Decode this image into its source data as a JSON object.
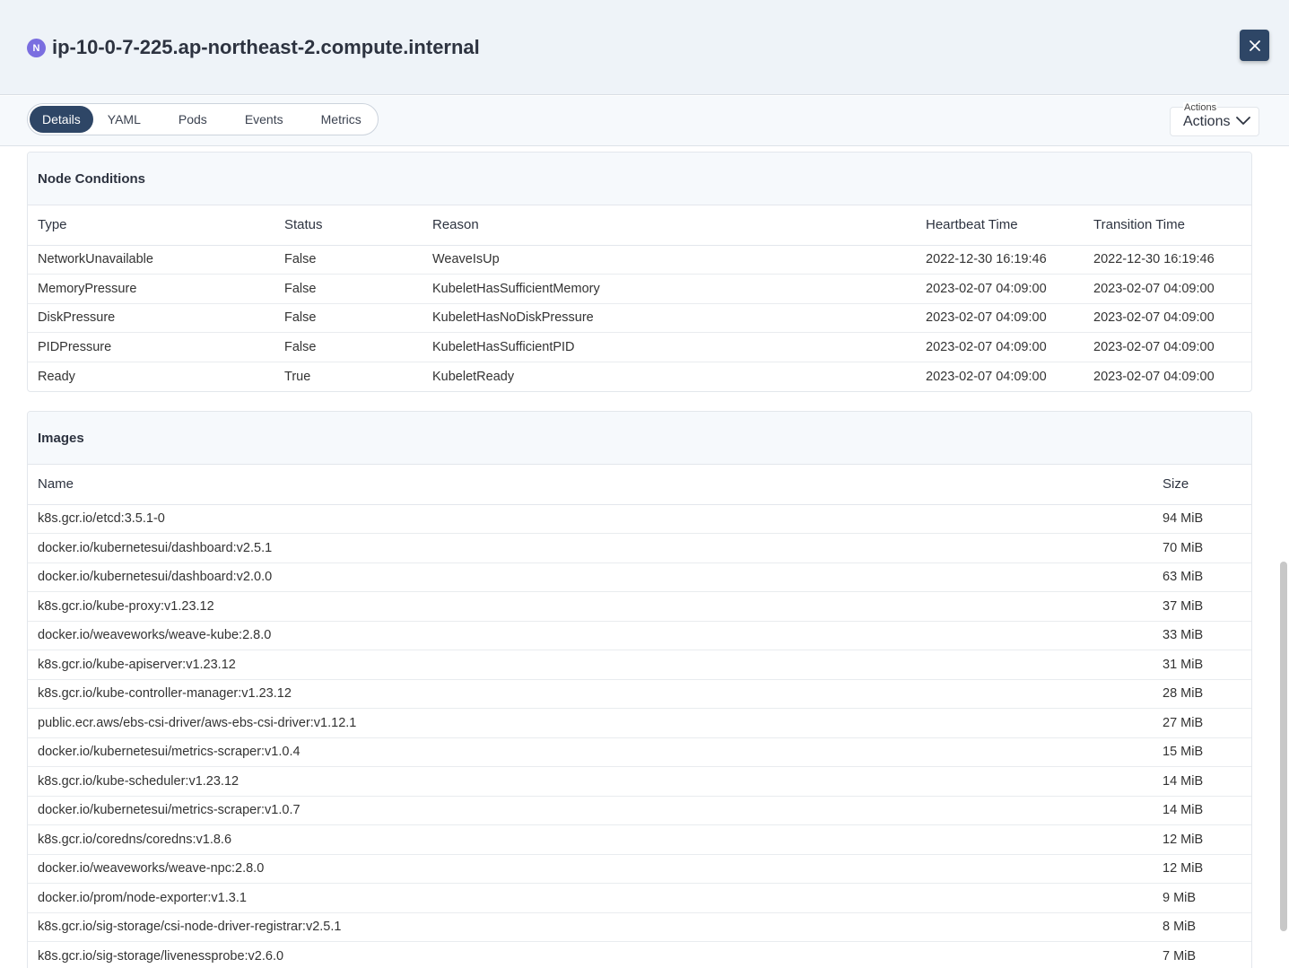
{
  "header": {
    "kind_badge": "N",
    "title": "ip-10-0-7-225.ap-northeast-2.compute.internal",
    "close_icon": "close-icon"
  },
  "tabs": [
    {
      "label": "Details",
      "active": true
    },
    {
      "label": "YAML",
      "active": false
    },
    {
      "label": "Pods",
      "active": false
    },
    {
      "label": "Events",
      "active": false
    },
    {
      "label": "Metrics",
      "active": false
    }
  ],
  "actions": {
    "caption": "Actions",
    "label": "Actions",
    "icon": "chevron-down-icon"
  },
  "node_conditions": {
    "title": "Node Conditions",
    "columns": [
      "Type",
      "Status",
      "Reason",
      "Heartbeat Time",
      "Transition Time"
    ],
    "rows": [
      [
        "NetworkUnavailable",
        "False",
        "WeaveIsUp",
        "2022-12-30 16:19:46",
        "2022-12-30 16:19:46"
      ],
      [
        "MemoryPressure",
        "False",
        "KubeletHasSufficientMemory",
        "2023-02-07 04:09:00",
        "2023-02-07 04:09:00"
      ],
      [
        "DiskPressure",
        "False",
        "KubeletHasNoDiskPressure",
        "2023-02-07 04:09:00",
        "2023-02-07 04:09:00"
      ],
      [
        "PIDPressure",
        "False",
        "KubeletHasSufficientPID",
        "2023-02-07 04:09:00",
        "2023-02-07 04:09:00"
      ],
      [
        "Ready",
        "True",
        "KubeletReady",
        "2023-02-07 04:09:00",
        "2023-02-07 04:09:00"
      ]
    ]
  },
  "images": {
    "title": "Images",
    "columns": [
      "Name",
      "Size"
    ],
    "rows": [
      [
        "k8s.gcr.io/etcd:3.5.1-0",
        "94 MiB"
      ],
      [
        "docker.io/kubernetesui/dashboard:v2.5.1",
        "70 MiB"
      ],
      [
        "docker.io/kubernetesui/dashboard:v2.0.0",
        "63 MiB"
      ],
      [
        "k8s.gcr.io/kube-proxy:v1.23.12",
        "37 MiB"
      ],
      [
        "docker.io/weaveworks/weave-kube:2.8.0",
        "33 MiB"
      ],
      [
        "k8s.gcr.io/kube-apiserver:v1.23.12",
        "31 MiB"
      ],
      [
        "k8s.gcr.io/kube-controller-manager:v1.23.12",
        "28 MiB"
      ],
      [
        "public.ecr.aws/ebs-csi-driver/aws-ebs-csi-driver:v1.12.1",
        "27 MiB"
      ],
      [
        "docker.io/kubernetesui/metrics-scraper:v1.0.4",
        "15 MiB"
      ],
      [
        "k8s.gcr.io/kube-scheduler:v1.23.12",
        "14 MiB"
      ],
      [
        "docker.io/kubernetesui/metrics-scraper:v1.0.7",
        "14 MiB"
      ],
      [
        "k8s.gcr.io/coredns/coredns:v1.8.6",
        "12 MiB"
      ],
      [
        "docker.io/weaveworks/weave-npc:2.8.0",
        "12 MiB"
      ],
      [
        "docker.io/prom/node-exporter:v1.3.1",
        "9 MiB"
      ],
      [
        "k8s.gcr.io/sig-storage/csi-node-driver-registrar:v2.5.1",
        "8 MiB"
      ],
      [
        "k8s.gcr.io/sig-storage/livenessprobe:v2.6.0",
        "7 MiB"
      ]
    ]
  },
  "colors": {
    "accent": "#2e4666",
    "badge": "#7a6ee0",
    "header_bg": "#eef3f8"
  }
}
